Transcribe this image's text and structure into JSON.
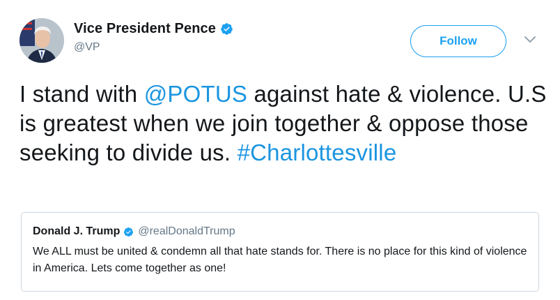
{
  "author": {
    "display_name": "Vice President Pence",
    "handle": "@VP",
    "verified_icon": "verified-badge-icon"
  },
  "actions": {
    "follow_label": "Follow",
    "more_icon": "chevron-down-icon"
  },
  "tweet": {
    "part1": "I stand with ",
    "mention": "@POTUS",
    "part2": " against hate & violence. U.S is greatest when we join together & oppose those seeking to divide us. ",
    "hashtag": "#Charlottesville"
  },
  "quoted_tweet": {
    "display_name": "Donald J. Trump",
    "handle": "@realDonaldTrump",
    "text": "We ALL must be united & condemn all that hate stands for. There is no place for this kind of violence in America. Lets come together as one!"
  },
  "colors": {
    "accent": "#1da1f2",
    "link": "#1b95e0",
    "text": "#14171a",
    "muted": "#657786",
    "border": "#ccd6dd"
  }
}
